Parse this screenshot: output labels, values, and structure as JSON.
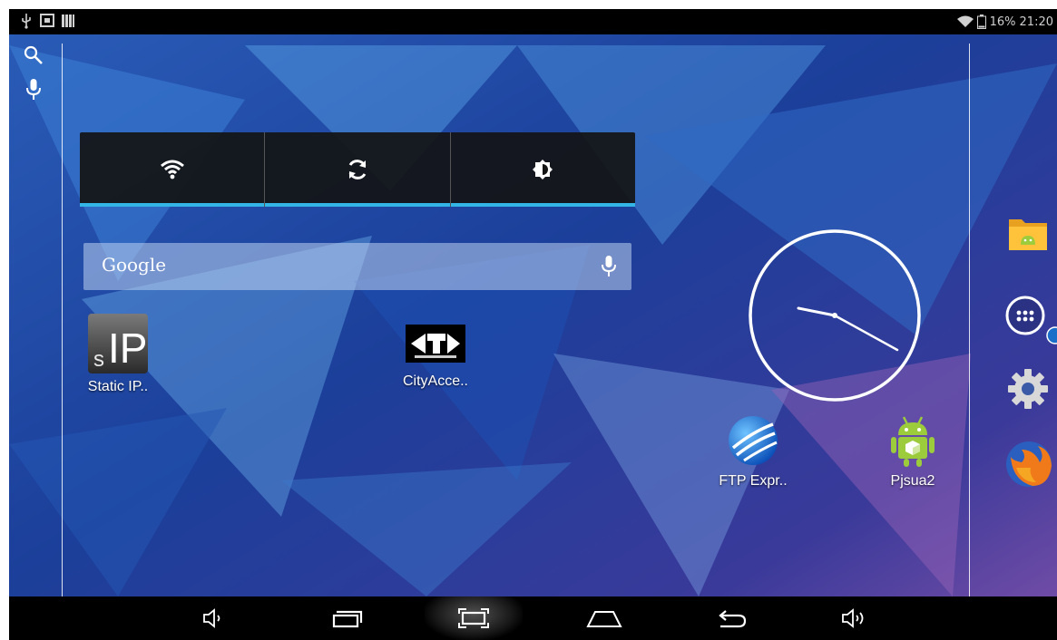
{
  "status_bar": {
    "battery_text": "16%",
    "time": "21:20",
    "left_icons": [
      "usb-icon",
      "cast-icon",
      "signal-bars-icon"
    ],
    "right_icons": [
      "wifi-icon",
      "battery-icon"
    ]
  },
  "left_strip": {
    "icons": [
      "search-icon",
      "mic-icon"
    ]
  },
  "power_widget": {
    "buttons": [
      "wifi-icon",
      "sync-icon",
      "brightness-icon"
    ],
    "accent": "#33b5e5"
  },
  "google_search": {
    "label": "Google",
    "icon": "mic-icon"
  },
  "apps": [
    {
      "label": "Static IP..",
      "icon": "static-ip-app-icon"
    },
    {
      "label": "CityAcce..",
      "icon": "city-access-app-icon"
    },
    {
      "label": "FTP Expr..",
      "icon": "ftp-express-app-icon"
    },
    {
      "label": "Pjsua2",
      "icon": "android-app-icon"
    }
  ],
  "dock": {
    "items": [
      "file-manager-icon",
      "all-apps-icon",
      "settings-icon",
      "firefox-icon"
    ]
  },
  "nav_bar": {
    "buttons": [
      "volume-down-icon",
      "recent-apps-icon",
      "screenshot-icon",
      "home-icon",
      "back-icon",
      "volume-up-icon"
    ]
  }
}
